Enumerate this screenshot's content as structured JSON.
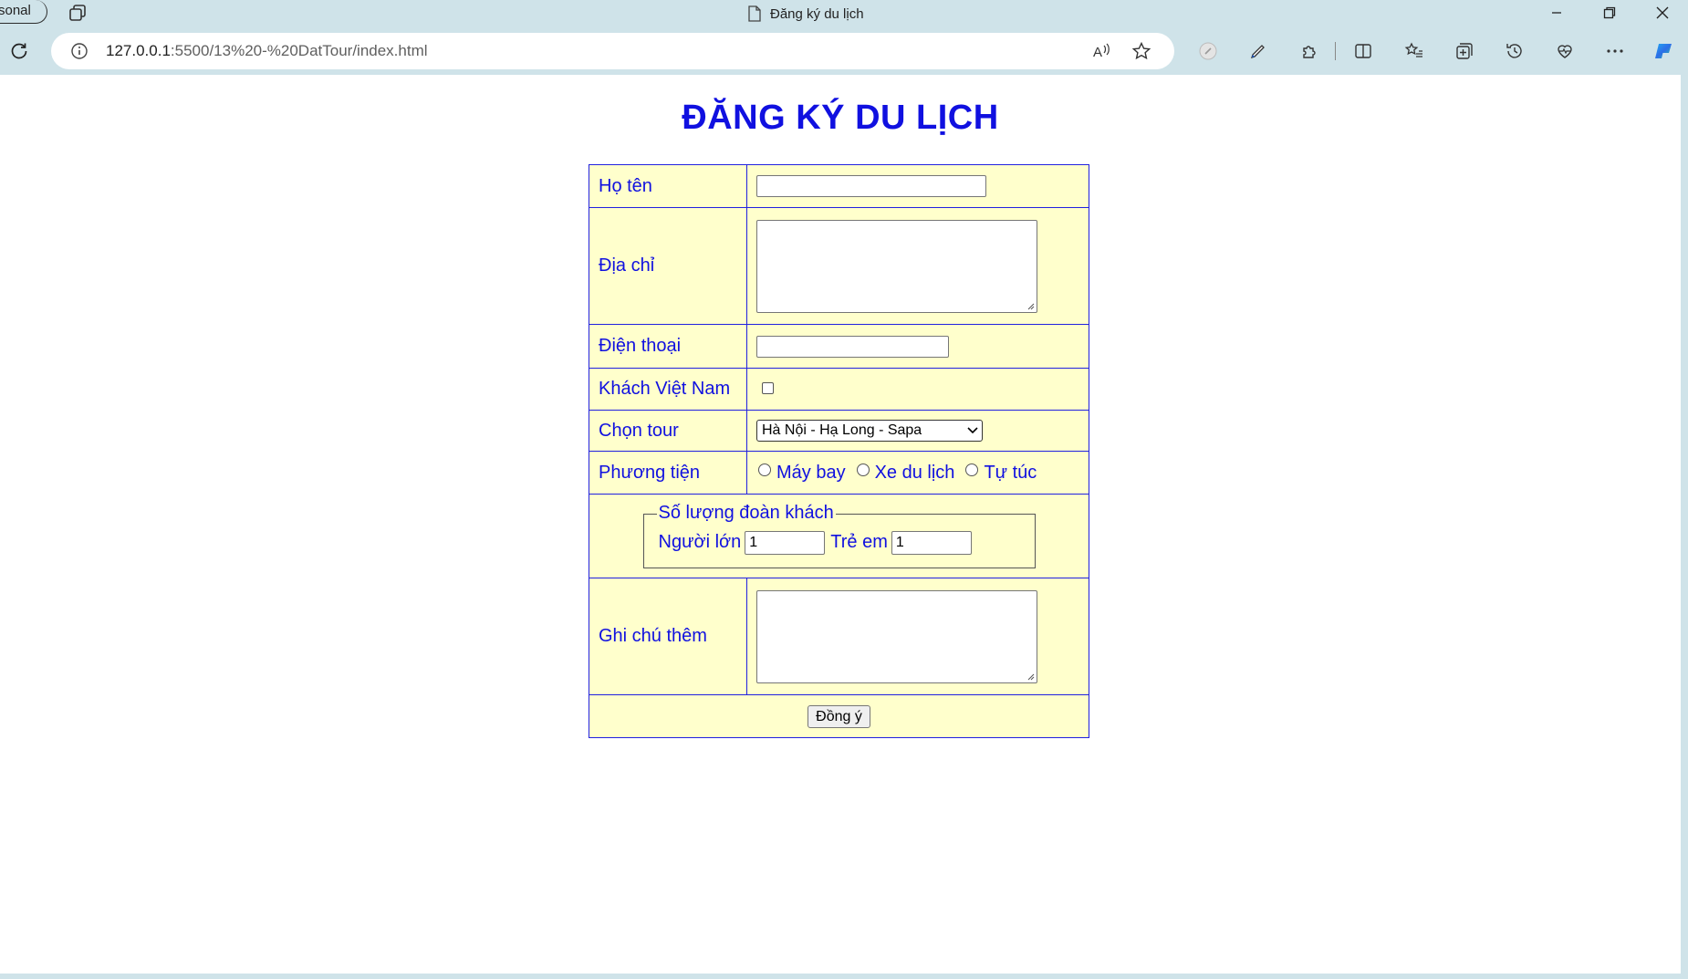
{
  "browser": {
    "profile_label": "sonal",
    "tab_title": "Đăng ký du lịch",
    "url_host": "127.0.0.1",
    "url_rest": ":5500/13%20-%20DatTour/index.html"
  },
  "page": {
    "title": "ĐĂNG KÝ DU LỊCH",
    "colors": {
      "text": "#1010e0",
      "table_bg": "#ffffcc",
      "border": "#2020e0"
    }
  },
  "form": {
    "name_label": "Họ tên",
    "name_value": "",
    "address_label": "Địa chỉ",
    "address_value": "",
    "phone_label": "Điện thoại",
    "phone_value": "",
    "vietnamese_label": "Khách Việt Nam",
    "vietnamese_checked": false,
    "tour_label": "Chọn tour",
    "tour_selected": "Hà Nội - Hạ Long - Sapa",
    "transport_label": "Phương tiện",
    "transport_options": [
      "Máy bay",
      "Xe du lịch",
      "Tự túc"
    ],
    "group_legend": "Số lượng đoàn khách",
    "adults_label": "Người lớn",
    "adults_value": "1",
    "children_label": "Trẻ em",
    "children_value": "1",
    "notes_label": "Ghi chú thêm",
    "notes_value": "",
    "submit_label": "Đồng ý"
  }
}
